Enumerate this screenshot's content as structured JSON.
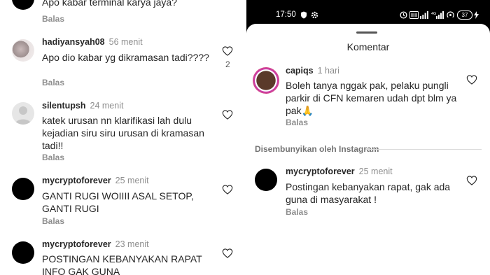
{
  "left_feed": {
    "comments": [
      {
        "username": "",
        "time": "",
        "text": "Apo kabar terminal karya jaya?",
        "reply": "Balas",
        "likes": ""
      },
      {
        "username": "hadiyansyah08",
        "time": "56 menit",
        "text": "Apo dio kabar yg dikramasan tadi????",
        "reply": "Balas",
        "likes": "2"
      },
      {
        "username": "silentupsh",
        "time": "24 menit",
        "text": "katek urusan nn klarifikasi lah dulu kejadian siru siru urusan di kramasan tadi!!",
        "reply": "Balas",
        "likes": ""
      },
      {
        "username": "mycryptoforever",
        "time": "25 menit",
        "text": "GANTI RUGI WOIIII ASAL SETOP, GANTI RUGI",
        "reply": "Balas",
        "likes": ""
      },
      {
        "username": "mycryptoforever",
        "time": "23 menit",
        "text": "POSTINGAN KEBANYAKAN RAPAT INFO GAK GUNA",
        "reply": "",
        "likes": ""
      }
    ]
  },
  "right_phone": {
    "status": {
      "clock": "17:50",
      "battery": "37"
    },
    "sheet_title": "Komentar",
    "comments": [
      {
        "username": "capiqs",
        "time": "1 hari",
        "text": "Boleh tanya nggak pak, pelaku pungli parkir di CFN kemaren udah dpt blm ya pak🙏",
        "reply": "Balas"
      },
      {
        "username": "mycryptoforever",
        "time": "25 menit",
        "text": "Postingan kebanyakan rapat, gak ada guna di masyarakat !",
        "reply": "Balas"
      }
    ],
    "hidden_label": "Disembunyikan oleh Instagram"
  },
  "icons": {
    "like": "heart-outline-icon"
  }
}
